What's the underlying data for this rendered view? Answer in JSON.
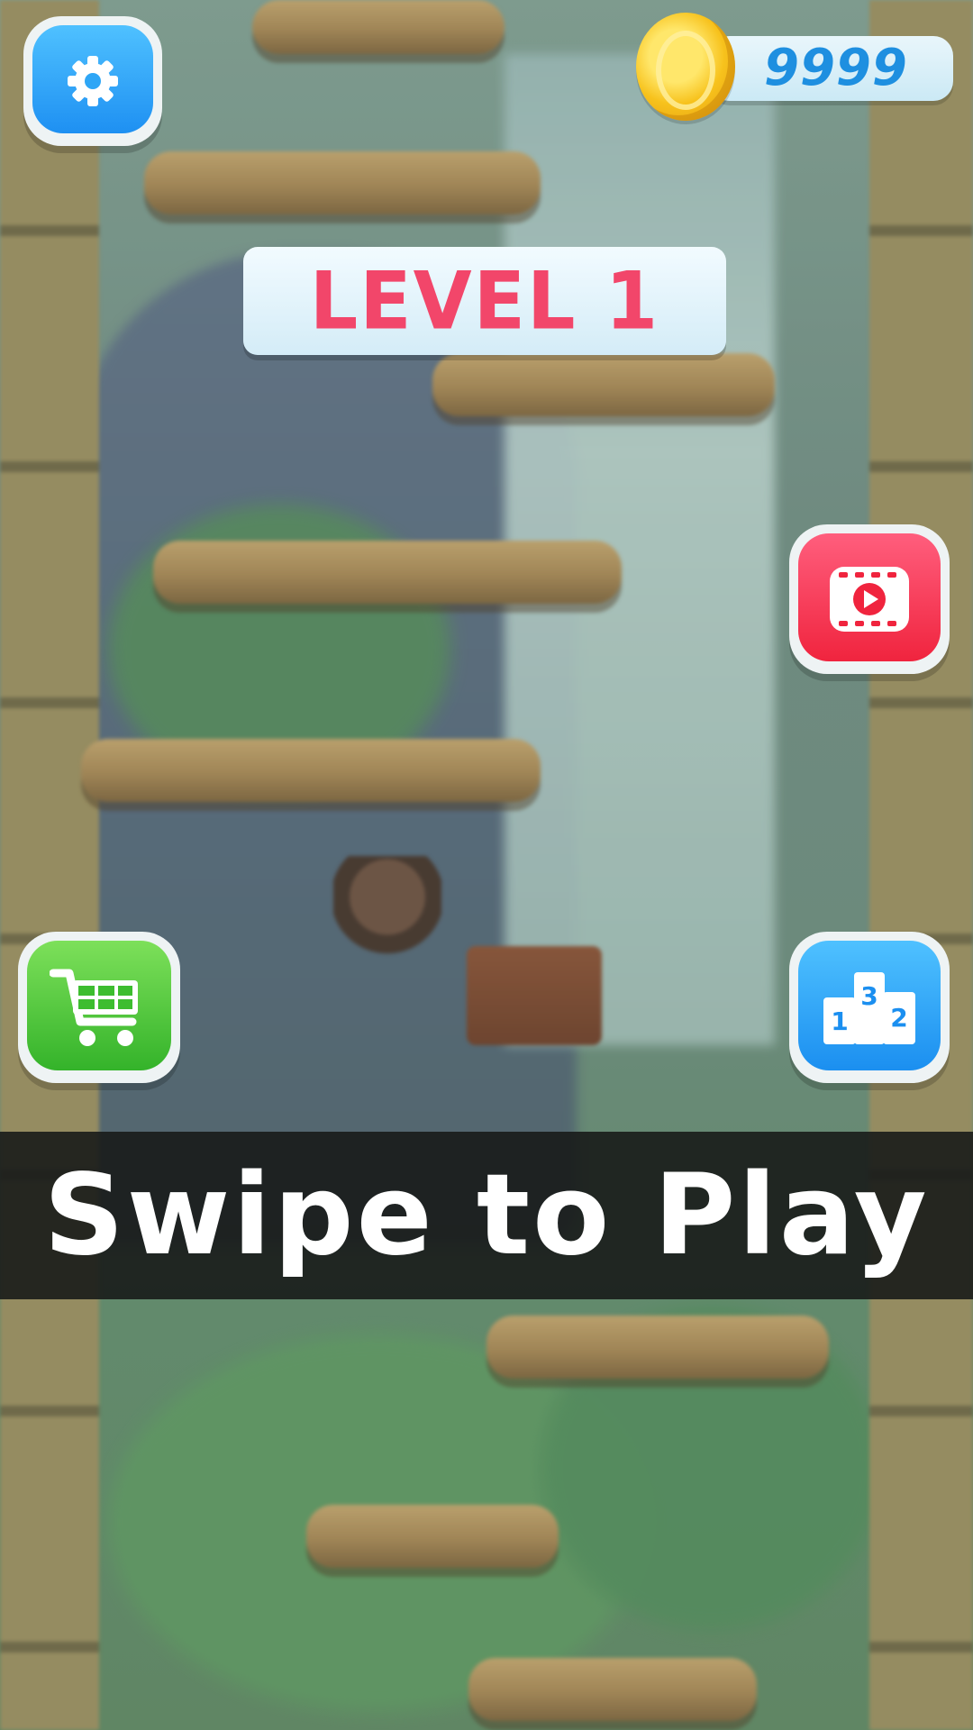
{
  "hud": {
    "coins": "9999",
    "level_label": "LEVEL 1",
    "prompt": "Swipe to Play"
  },
  "buttons": {
    "settings": {
      "icon": "gear-icon",
      "color": "#1e90f2"
    },
    "watch_video": {
      "icon": "play-video-icon",
      "color": "#f0243e"
    },
    "shop": {
      "icon": "shopping-cart-icon",
      "color": "#34b32a"
    },
    "leaderboard": {
      "icon": "podium-icon",
      "color": "#1b8ff0",
      "podium_places": [
        "1",
        "3",
        "2"
      ]
    }
  },
  "colors": {
    "level_text": "#f2466a",
    "coin_text": "#1e8fe0",
    "prompt_band": "#181b19"
  }
}
